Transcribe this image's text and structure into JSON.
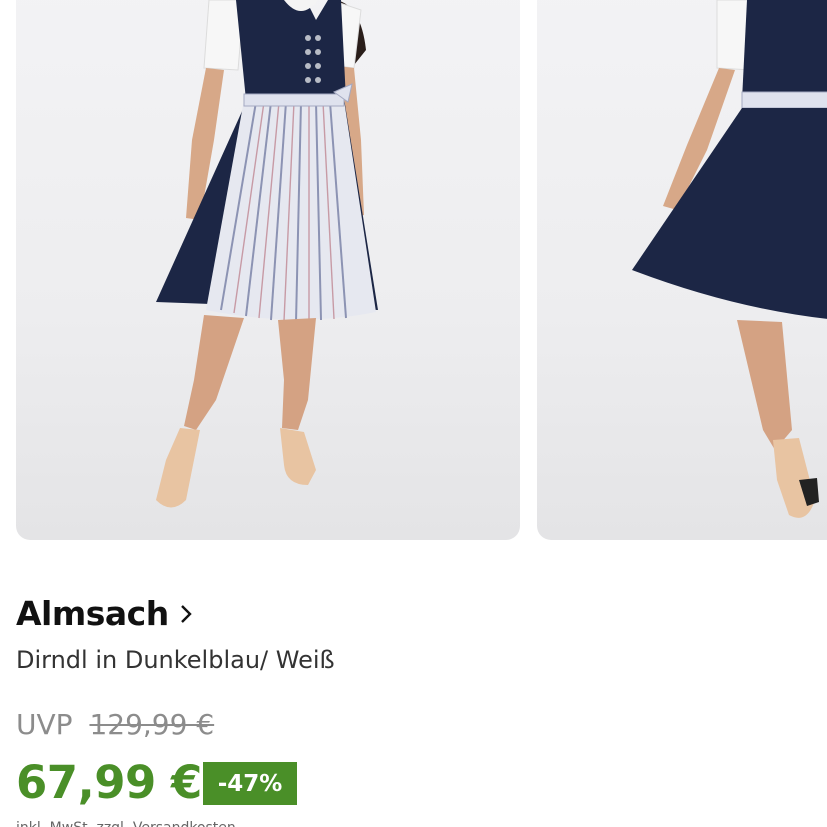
{
  "product": {
    "brand": "Almsach",
    "title": "Dirndl in Dunkelblau/ Weiß",
    "uvp_label": "UVP",
    "old_price": "129,99 €",
    "price": "67,99 €",
    "discount": "-47%",
    "info_cut": "inkl. MwSt. zzgl. Versandkosten"
  },
  "gallery": {
    "images": [
      "product-photo-front",
      "product-photo-side"
    ]
  },
  "colors": {
    "price_green": "#4a8f28",
    "dress_navy": "#1c2645",
    "strike_gray": "#8c8c8c"
  }
}
